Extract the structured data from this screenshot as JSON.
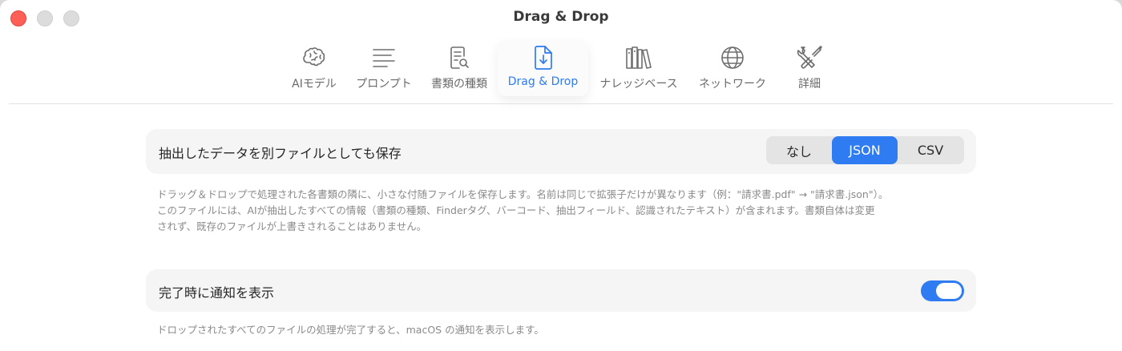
{
  "window": {
    "title": "Drag & Drop"
  },
  "toolbar": {
    "tabs": [
      {
        "label": "AIモデル",
        "icon": "brain-icon"
      },
      {
        "label": "プロンプト",
        "icon": "text-lines-icon"
      },
      {
        "label": "書類の種類",
        "icon": "document-search-icon"
      },
      {
        "label": "Drag & Drop",
        "icon": "document-download-icon",
        "active": true
      },
      {
        "label": "ナレッジベース",
        "icon": "books-icon"
      },
      {
        "label": "ネットワーク",
        "icon": "globe-icon"
      },
      {
        "label": "詳細",
        "icon": "tools-icon"
      }
    ]
  },
  "settings": {
    "save_extracted": {
      "label": "抽出したデータを別ファイルとしても保存",
      "options": [
        "なし",
        "JSON",
        "CSV"
      ],
      "selected": "JSON",
      "description_lines": [
        "ドラッグ＆ドロップで処理された各書類の隣に、小さな付随ファイルを保存します。名前は同じで拡張子だけが異なります（例：\"請求書.pdf\" → \"請求書.json\"）。",
        "このファイルには、AIが抽出したすべての情報（書類の種類、Finderタグ、バーコード、抽出フィールド、認識されたテキスト）が含まれます。書類自体は変更",
        "されず、既存のファイルが上書きされることはありません。"
      ]
    },
    "notify_on_complete": {
      "label": "完了時に通知を表示",
      "enabled": true,
      "description": "ドロップされたすべてのファイルの処理が完了すると、macOS の通知を表示します。"
    }
  },
  "colors": {
    "accent": "#2f7bf2",
    "close": "#fe5f57"
  }
}
